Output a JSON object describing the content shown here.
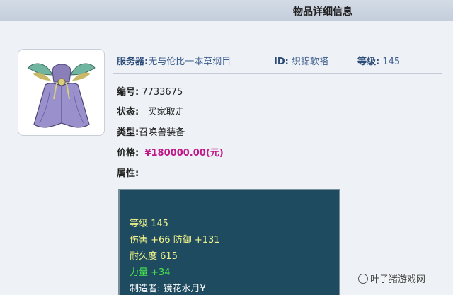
{
  "header": {
    "title": "物品详细信息"
  },
  "item_info": {
    "server_label": "服务器:",
    "server_value": "无与伦比一本草纲目",
    "id_label": "ID:",
    "id_value": "织锦软褡",
    "level_label": "等级:",
    "level_value": "145"
  },
  "details": {
    "number_label": "编号:",
    "number_value": "7733675",
    "status_label": "状态:",
    "status_value": "买家取走",
    "type_label": "类型:",
    "type_value": "召唤兽装备",
    "price_label": "价格:",
    "price_value": "¥180000.00(元)",
    "attributes_label": "属性:"
  },
  "attributes": {
    "level": "等级 145",
    "damage_defense": "伤害 +66 防御 +131",
    "durability": "耐久度 615",
    "strength": "力量 +34",
    "maker": "制造者: 镜花水月¥"
  },
  "watermark": {
    "text": "叶子猪游戏网"
  },
  "colors": {
    "price": "#c0188a",
    "attr_panel_bg": "#1e4b60",
    "attr_text_yellow": "#f2f38a",
    "attr_text_green": "#48e44e"
  },
  "icons": {
    "item_image": "pet-armor-icon"
  }
}
